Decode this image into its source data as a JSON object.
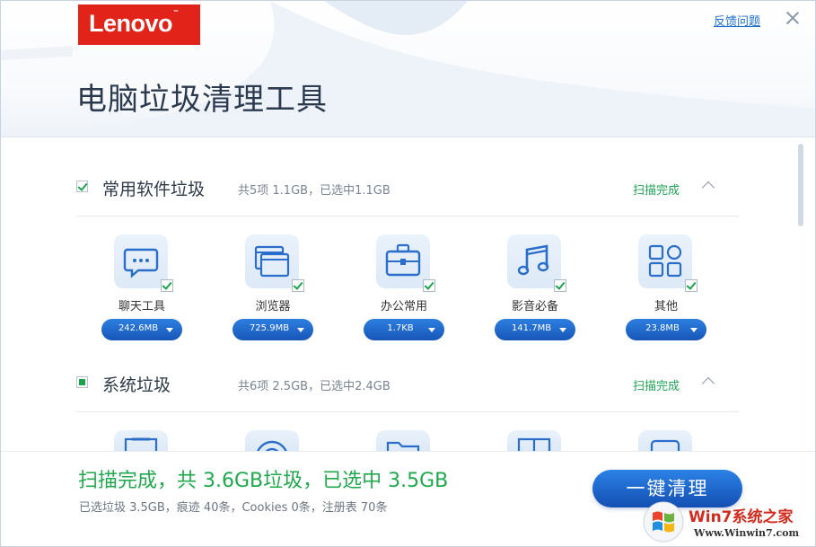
{
  "header": {
    "logo_text": "Lenovo",
    "title": "电脑垃圾清理工具",
    "feedback_link": "反馈问题"
  },
  "sections": [
    {
      "title": "常用软件垃圾",
      "summary": "共5项 1.1GB，已选中1.1GB",
      "status": "扫描完成",
      "checked": true,
      "items": [
        {
          "label": "聊天工具",
          "size": "242.6MB",
          "icon": "chat-icon"
        },
        {
          "label": "浏览器",
          "size": "725.9MB",
          "icon": "browser-windows-icon"
        },
        {
          "label": "办公常用",
          "size": "1.7KB",
          "icon": "briefcase-icon"
        },
        {
          "label": "影音必备",
          "size": "141.7MB",
          "icon": "music-note-icon"
        },
        {
          "label": "其他",
          "size": "23.8MB",
          "icon": "grid-apps-icon"
        }
      ]
    },
    {
      "title": "系统垃圾",
      "summary": "共6项 2.5GB，已选中2.4GB",
      "status": "扫描完成",
      "checked": "partial"
    }
  ],
  "footer": {
    "headline": "扫描完成，共 3.6GB垃圾，已选中 3.5GB",
    "detail": "已选垃圾 3.5GB，痕迹 40条，Cookies 0条，注册表 70条",
    "clean_button": "一键清理"
  },
  "watermark": {
    "text": "Win7系统之家",
    "url": "Www.Winwin7.com"
  },
  "colors": {
    "lenovo_red": "#e2231a",
    "accent_blue": "#1f6fd0",
    "success_green": "#21a84e"
  }
}
